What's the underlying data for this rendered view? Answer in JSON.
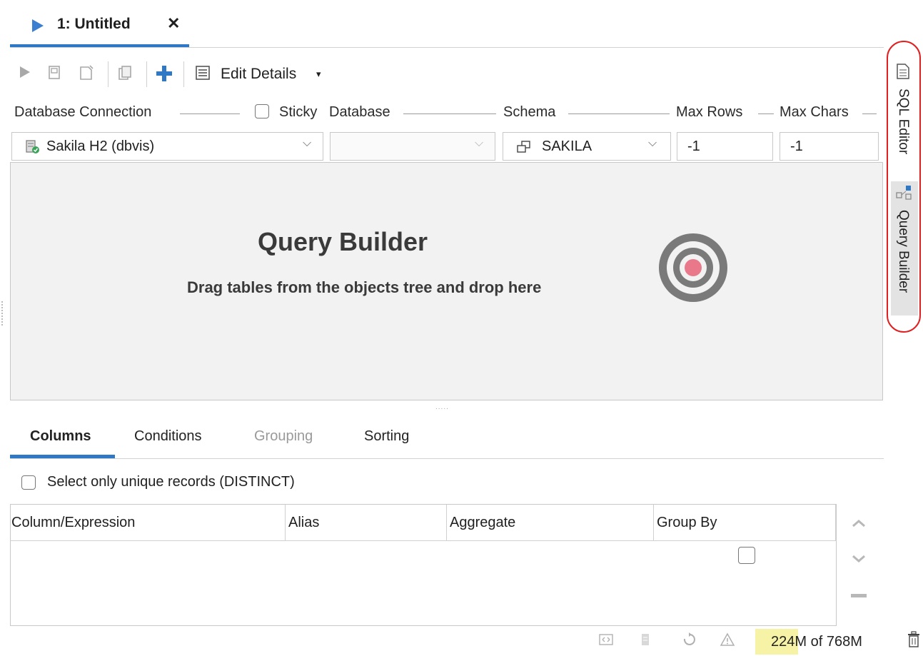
{
  "tab": {
    "title": "1: Untitled",
    "close": "✕"
  },
  "toolbar": {
    "edit_details_label": "Edit Details",
    "caret": "▾"
  },
  "connection": {
    "db_connection_label": "Database Connection",
    "sticky_label": "Sticky",
    "database_label": "Database",
    "schema_label": "Schema",
    "max_rows_label": "Max Rows",
    "max_chars_label": "Max Chars",
    "connection_value": "Sakila H2 (dbvis)",
    "database_value": "",
    "schema_value": "SAKILA",
    "max_rows_value": "-1",
    "max_chars_value": "-1"
  },
  "builder": {
    "title": "Query Builder",
    "subtitle": "Drag tables from the objects tree and drop here",
    "splitter": "....."
  },
  "lower_tabs": [
    {
      "label": "Columns",
      "active": true
    },
    {
      "label": "Conditions",
      "active": false
    },
    {
      "label": "Grouping",
      "active": false,
      "disabled": true
    },
    {
      "label": "Sorting",
      "active": false
    }
  ],
  "distinct_label": "Select only unique records (DISTINCT)",
  "grid": {
    "headers": [
      "Column/Expression",
      "Alias",
      "Aggregate",
      "Group By"
    ]
  },
  "status": {
    "memory_used": "224",
    "memory_text": "M of 768M"
  },
  "side_panel": {
    "sql_editor_label": "SQL Editor",
    "query_builder_label": "Query Builder"
  },
  "colors": {
    "accent": "#2f78c6",
    "highlight_oval": "#e02020",
    "memory_bar": "#f6f2a6",
    "target_dot": "#e8788a"
  }
}
